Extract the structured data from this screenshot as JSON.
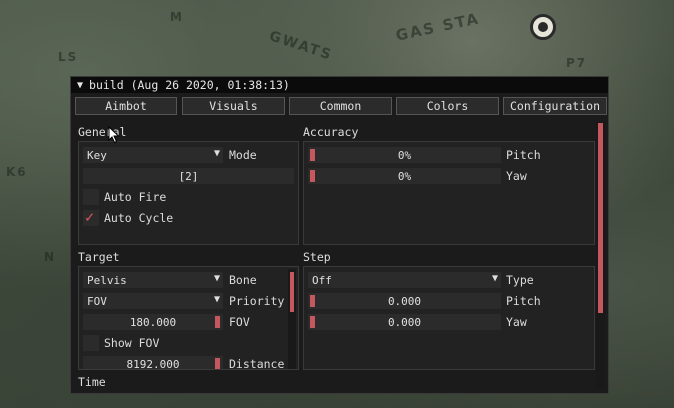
{
  "background": {
    "map_labels": [
      "GAS STA",
      "GWATS",
      "LS",
      "M",
      "K6",
      "N",
      "P7"
    ]
  },
  "window": {
    "title": "build (Aug 26 2020, 01:38:13)",
    "tabs": [
      "Aimbot",
      "Visuals",
      "Common",
      "Colors",
      "Configuration"
    ]
  },
  "general": {
    "title": "General",
    "key_value": "Key",
    "key_label": "Mode",
    "key_binding": "[2]",
    "auto_fire_label": "Auto Fire",
    "auto_fire_checked": false,
    "auto_cycle_label": "Auto Cycle",
    "auto_cycle_checked": true
  },
  "accuracy": {
    "title": "Accuracy",
    "pitch_value": "0%",
    "pitch_label": "Pitch",
    "yaw_value": "0%",
    "yaw_label": "Yaw"
  },
  "target": {
    "title": "Target",
    "bone_value": "Pelvis",
    "bone_label": "Bone",
    "priority_value": "FOV",
    "priority_label": "Priority",
    "fov_value": "180.000",
    "fov_label": "FOV",
    "show_fov_label": "Show FOV",
    "show_fov_checked": false,
    "distance_value": "8192.000",
    "distance_label": "Distance"
  },
  "step": {
    "title": "Step",
    "type_value": "Off",
    "type_label": "Type",
    "pitch_value": "0.000",
    "pitch_label": "Pitch",
    "yaw_value": "0.000",
    "yaw_label": "Yaw"
  },
  "time": {
    "title": "Time"
  },
  "colors": {
    "accent": "#c4585e",
    "window_bg": "#1b1b1b",
    "title_bg": "#0b0b0b"
  }
}
